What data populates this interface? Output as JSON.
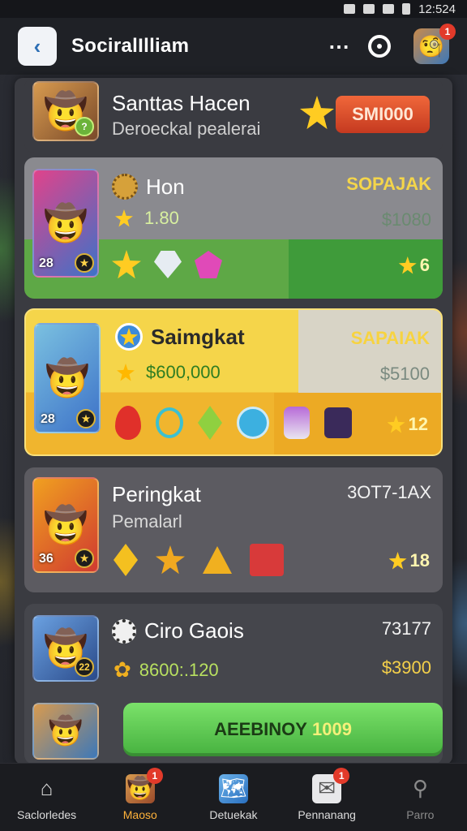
{
  "status": {
    "time": "12:524"
  },
  "header": {
    "title": "SociralIlliam",
    "notif_count": "1"
  },
  "rows": [
    {
      "name": "Santtas Hacen",
      "sub": "Deroeckal pealerai",
      "button": "SMI000"
    },
    {
      "name": "Hon",
      "score": "1.80",
      "label": "SOPAJAK",
      "value": "$1080",
      "badge": "28",
      "stars": "6"
    },
    {
      "name": "Saimgkat",
      "score": "$600,000",
      "label": "SAPAIAK",
      "value": "$5100",
      "badge": "28",
      "stars": "12"
    },
    {
      "name": "Peringkat",
      "sub": "Pemalarl",
      "label": "3OT7-1AX",
      "badge": "36",
      "stars": "18"
    },
    {
      "name": "Ciro Gaois",
      "score": "8600:.120",
      "label": "73177",
      "value": "$3900",
      "badge": "22"
    }
  ],
  "cta": {
    "label": "AEEBINOY",
    "number": "1009"
  },
  "nav": [
    {
      "label": "Saclorledes",
      "badge": ""
    },
    {
      "label": "Maoso",
      "badge": "1"
    },
    {
      "label": "Detuekak",
      "badge": ""
    },
    {
      "label": "Pennanang",
      "badge": "1"
    },
    {
      "label": "Parro",
      "badge": ""
    }
  ]
}
